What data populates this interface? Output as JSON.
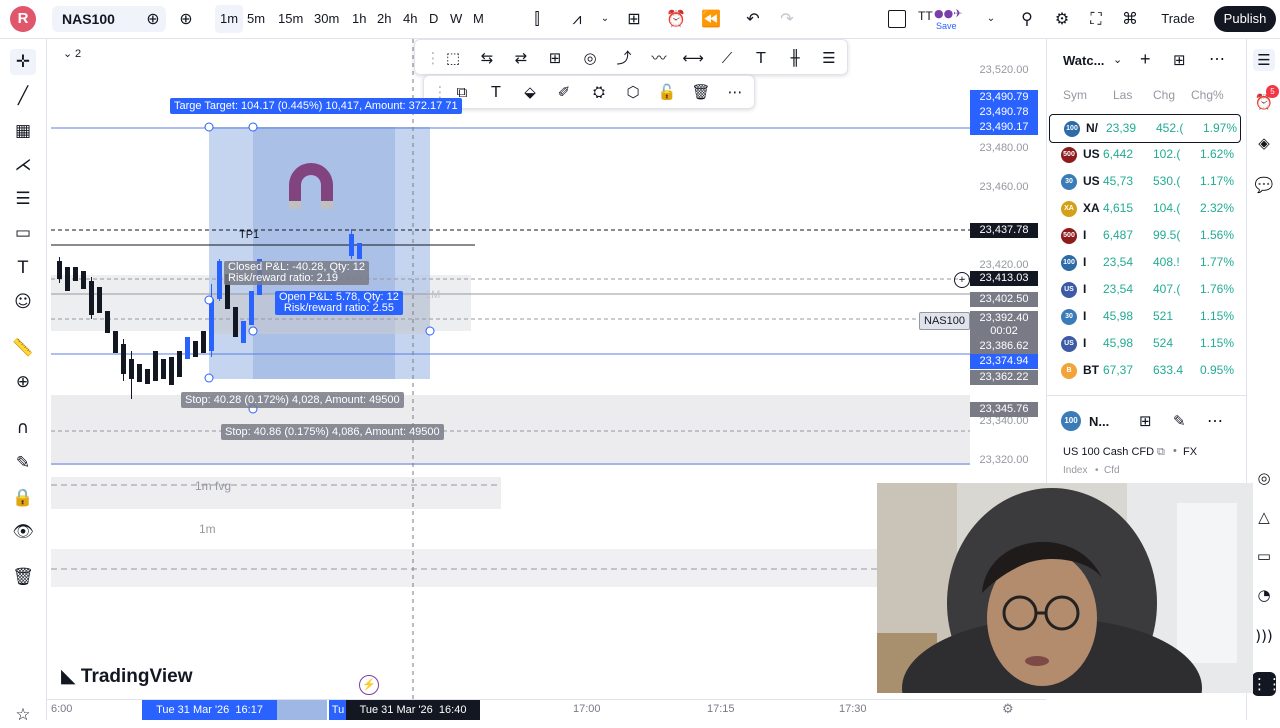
{
  "app": {
    "logo": "R",
    "symbol": "NAS100",
    "brand": "TradingView"
  },
  "toolbar": {
    "timeframes": [
      "1m",
      "5m",
      "15m",
      "30m",
      "1h",
      "2h",
      "4h",
      "D",
      "W",
      "M"
    ],
    "active_timeframe": "1m",
    "layout_name": "TT",
    "save_label": "Save",
    "trade_label": "Trade",
    "publish_label": "Publish"
  },
  "price_axis": {
    "ticks": [
      "23,520.00",
      "23,480.00",
      "23,460.00",
      "23,420.00",
      "23,340.00",
      "23,320.00"
    ],
    "labels": [
      {
        "text": "23,490.79",
        "color": "#2962ff"
      },
      {
        "text": "23,490.78",
        "color": "#2962ff"
      },
      {
        "text": "23,490.17",
        "color": "#2962ff"
      },
      {
        "text": "23,437.78",
        "color": "#131722"
      },
      {
        "text": "23,413.03",
        "color": "#131722"
      },
      {
        "text": "23,402.50",
        "color": "#787b86"
      },
      {
        "text": "23,392.40",
        "color": "#787b86"
      },
      {
        "text": "00:02",
        "color": "#787b86"
      },
      {
        "text": "23,386.62",
        "color": "#787b86"
      },
      {
        "text": "23,374.94",
        "color": "#2962ff"
      },
      {
        "text": "23,362.22",
        "color": "#787b86"
      },
      {
        "text": "23,345.76",
        "color": "#787b86"
      }
    ],
    "symbol_tag": "NAS100"
  },
  "time_axis": {
    "ticks": [
      "6:00",
      "17:00",
      "17:15",
      "17:30"
    ],
    "start_label": "Tue 31 Mar '26  16:17",
    "cursor_label": "Tue 31 Mar '26  16:40",
    "hidden_label": "Tu"
  },
  "chart": {
    "target_label": "Targe Target: 104.17 (0.445%) 10,417, Amount: 372.17 71",
    "stop_label_1": "Stop: 40.28 (0.172%) 4,028, Amount: 49500",
    "stop_label_2": "Stop: 40.86 (0.175%) 4,086, Amount: 49500",
    "closed_pl": "Closed P&L: -40.28, Qty: 12",
    "closed_rr": "Risk/reward ratio: 2.19",
    "open_pl": "Open P&L: 5.78, Qty: 12",
    "open_rr": "Risk/reward ratio: 2.55",
    "tp1": "TP1",
    "zone_1m": "1M",
    "fvg_label": "1m fvg",
    "zone_1m_lower": "1m",
    "interval_badge": "2"
  },
  "watchlist": {
    "title": "Watc...",
    "columns": [
      "Sym",
      "Las",
      "Chg",
      "Chg%"
    ],
    "rows": [
      {
        "badge": "100",
        "badge_color": "#2d6aa8",
        "sym": "N/",
        "last": "23,39",
        "chg": "452.(",
        "chgp": "1.97%"
      },
      {
        "badge": "500",
        "badge_color": "#8e1c1c",
        "sym": "US",
        "last": "6,442",
        "chg": "102.(",
        "chgp": "1.62%"
      },
      {
        "badge": "30",
        "badge_color": "#3a7bb8",
        "sym": "US",
        "last": "45,73",
        "chg": "530.(",
        "chgp": "1.17%"
      },
      {
        "badge": "XA",
        "badge_color": "#d4a018",
        "sym": "XA",
        "last": "4,615",
        "chg": "104.(",
        "chgp": "2.32%"
      },
      {
        "badge": "500",
        "badge_color": "#8e1c1c",
        "sym": "I",
        "last": "6,487",
        "chg": "99.5(",
        "chgp": "1.56%"
      },
      {
        "badge": "100",
        "badge_color": "#2d6aa8",
        "sym": "I",
        "last": "23,54",
        "chg": "408.!",
        "chgp": "1.77%"
      },
      {
        "badge": "US",
        "badge_color": "#3c5aa6",
        "sym": "I",
        "last": "23,54",
        "chg": "407.(",
        "chgp": "1.76%"
      },
      {
        "badge": "30",
        "badge_color": "#3a7bb8",
        "sym": "I",
        "last": "45,98",
        "chg": "521",
        "chgp": "1.15%"
      },
      {
        "badge": "US",
        "badge_color": "#3c5aa6",
        "sym": "I",
        "last": "45,98",
        "chg": "524",
        "chgp": "1.15%"
      },
      {
        "badge": "B",
        "badge_color": "#f2a33a",
        "sym": "BT",
        "last": "67,37",
        "chg": "633.4",
        "chgp": "0.95%"
      }
    ],
    "detail_name": "N...",
    "detail_desc": "US 100 Cash CFD",
    "detail_exchange": "FX",
    "detail_type": "Index",
    "detail_sub": "Cfd",
    "notifications": "5"
  }
}
